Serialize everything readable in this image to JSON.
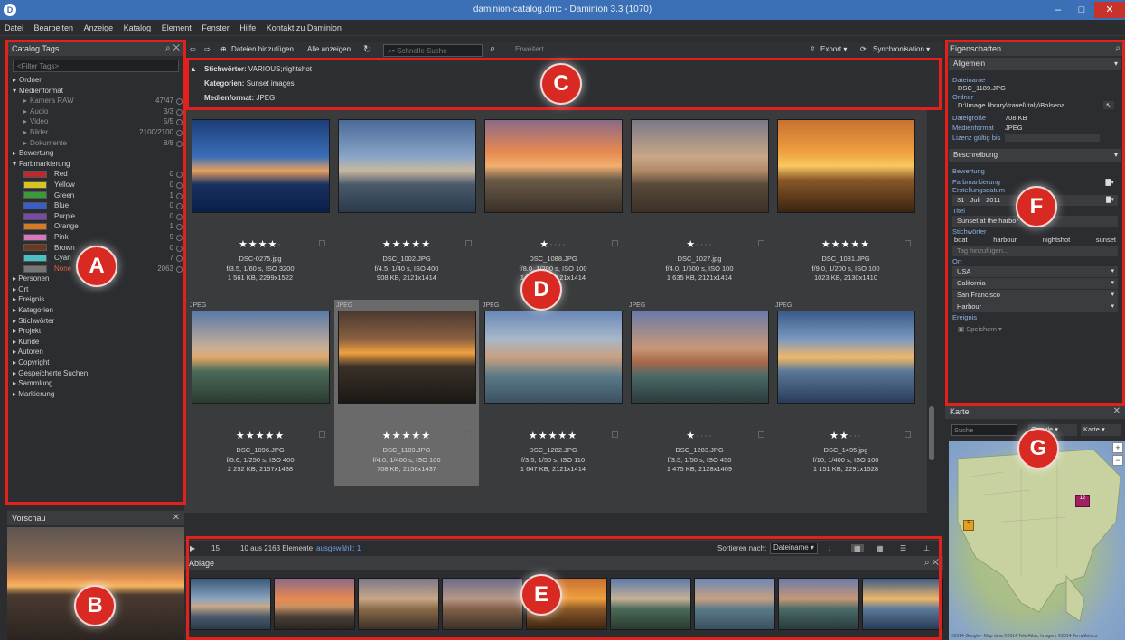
{
  "window": {
    "title": "daminion-catalog.dmc - Daminion 3.3 (1070)",
    "minimize": "–",
    "maximize": "□",
    "close": "✕"
  },
  "menu": [
    "Datei",
    "Bearbeiten",
    "Anzeige",
    "Katalog",
    "Element",
    "Fenster",
    "Hilfe",
    "Kontakt zu Daminion"
  ],
  "catalog_tags": {
    "title": "Catalog Tags",
    "filter_placeholder": "<Filter Tags>",
    "items": [
      {
        "label": "Ordner",
        "level": 0,
        "expander": "▸"
      },
      {
        "label": "Medienformat",
        "level": 0,
        "expander": "▾"
      },
      {
        "label": "Kamera RAW",
        "level": 1,
        "count": "47/47",
        "expander": "▸"
      },
      {
        "label": "Audio",
        "level": 1,
        "count": "3/3",
        "expander": "▸"
      },
      {
        "label": "Video",
        "level": 1,
        "count": "5/5",
        "expander": "▸"
      },
      {
        "label": "Bilder",
        "level": 1,
        "count": "2100/2100",
        "expander": "▸"
      },
      {
        "label": "Dokumente",
        "level": 1,
        "count": "8/8",
        "expander": "▸"
      },
      {
        "label": "Bewertung",
        "level": 0,
        "expander": "▸"
      },
      {
        "label": "Farbmarkierung",
        "level": 0,
        "expander": "▾"
      }
    ],
    "colors": [
      {
        "label": "Red",
        "count": "0",
        "color": "#c0282d"
      },
      {
        "label": "Yellow",
        "count": "0",
        "color": "#d8c620"
      },
      {
        "label": "Green",
        "count": "1",
        "color": "#3a9a3a"
      },
      {
        "label": "Blue",
        "count": "0",
        "color": "#3a5ec8"
      },
      {
        "label": "Purple",
        "count": "0",
        "color": "#7a4aa8"
      },
      {
        "label": "Orange",
        "count": "1",
        "color": "#d77a22"
      },
      {
        "label": "Pink",
        "count": "9",
        "color": "#d878b8"
      },
      {
        "label": "Brown",
        "count": "0",
        "color": "#6a3a1a"
      },
      {
        "label": "Cyan",
        "count": "7",
        "color": "#4ac0c0"
      },
      {
        "label": "None",
        "count": "2063",
        "color": "#777777",
        "highlight": true
      }
    ],
    "more_items": [
      "Personen",
      "Ort",
      "Ereignis",
      "Kategorien",
      "Stichwörter",
      "Projekt",
      "Kunde",
      "Autoren",
      "Copyright",
      "Gespeicherte Suchen",
      "Sammlung",
      "Markierung"
    ]
  },
  "preview": {
    "title": "Vorschau"
  },
  "toolbar": {
    "add_files": "Dateien hinzufügen",
    "show_all": "Alle anzeigen",
    "search_placeholder": "Schnelle Suche",
    "extended": "Erweitert",
    "export": "Export",
    "sync": "Synchronisation"
  },
  "filter_info": {
    "keywords_label": "Stichwörter:",
    "keywords_value": "VARIOUS;nightshot",
    "categories_label": "Kategorien:",
    "categories_value": "Sunset images",
    "media_label": "Medienformat:",
    "media_value": "JPEG"
  },
  "thumbs": [
    {
      "name": "DSC-0275.jpg",
      "exif": "f/3.5, 1/60 s, ISO 3200",
      "size": "1 561 KB, 2299x1522",
      "rating": 4,
      "fmt": "",
      "img": "linear-gradient(180deg,#1c3d78 0%,#3a6fb8 40%,#e8a060 55%,#183060 70%,#0a1e48 100%)"
    },
    {
      "name": "DSC_1002.JPG",
      "exif": "f/4.5, 1/40 s, ISO 400",
      "size": "908 KB, 2121x1414",
      "rating": 5,
      "fmt": "",
      "img": "linear-gradient(180deg,#4a6a98 0%,#8aa4c8 40%,#c8b8a0 55%,#4a5a6a 70%,#2a3a4a 100%)"
    },
    {
      "name": "DSC_1088.JPG",
      "exif": "f/8.0, 1/200 s, ISO 100",
      "size": "1 320 KB, 2121x1414",
      "rating": 1,
      "fmt": "",
      "img": "linear-gradient(180deg,#8a6a88 0%,#e88a50 35%,#f0b070 50%,#6a5a48 65%,#3a3028 100%)"
    },
    {
      "name": "DSC_1027.jpg",
      "exif": "f/4.0, 1/500 s, ISO 100",
      "size": "1 635 KB, 2121x1414",
      "rating": 1,
      "fmt": "",
      "img": "linear-gradient(180deg,#7a7888 0%,#c8a888 40%,#b08a68 55%,#5a4a3a 70%,#3a3028 100%)"
    },
    {
      "name": "DSC_1081.JPG",
      "exif": "f/9.0, 1/200 s, ISO 100",
      "size": "1023 KB, 2130x1410",
      "rating": 5,
      "fmt": "",
      "img": "linear-gradient(180deg,#c87030 0%,#f0a040 35%,#f8c860 50%,#8a5828 65%,#3a2410 100%)"
    },
    {
      "name": "DSC_1096.JPG",
      "exif": "f/5.6, 1/250 s, ISO 400",
      "size": "2 252 KB, 2157x1438",
      "rating": 5,
      "fmt": "JPEG",
      "img": "linear-gradient(180deg,#5a7aa8 0%,#c8b098 40%,#e0a868 50%,#4a6a58 65%,#2a3a30 100%)"
    },
    {
      "name": "DSC_1189.JPG",
      "exif": "f/4.0, 1/400 s, ISO 100",
      "size": "708 KB, 2156x1437",
      "rating": 5,
      "fmt": "JPEG",
      "img": "linear-gradient(180deg,#4a3a30 0%,#8a6040 30%,#f0a040 45%,#3a3028 60%,#1a1814 100%)"
    },
    {
      "name": "DSC_1282.JPG",
      "exif": "f/3.5, 1/50 s, ISO 110",
      "size": "1 647 KB, 2121x1414",
      "rating": 5,
      "fmt": "JPEG",
      "img": "linear-gradient(180deg,#6a88b8 0%,#a8b8c8 30%,#c8a080 50%,#5a7a88 70%,#3a5060 100%)"
    },
    {
      "name": "DSC_1283.JPG",
      "exif": "f/3.5, 1/50 s, ISO 450",
      "size": "1 475 KB, 2128x1409",
      "rating": 1,
      "fmt": "JPEG",
      "img": "linear-gradient(180deg,#6a7aa8 0%,#c89878 40%,#a86848 55%,#4a6a68 70%,#2a3a3a 100%)"
    },
    {
      "name": "DSC_1495.jpg",
      "exif": "f/10, 1/400 s, ISO 100",
      "size": "1 151 KB, 2291x1528",
      "rating": 2,
      "fmt": "JPEG",
      "img": "linear-gradient(180deg,#3a5a88 0%,#7a98c0 30%,#f0b868 50%,#5a7898 65%,#2a3a58 100%)"
    }
  ],
  "status": {
    "count_text": "15",
    "elements_text": "10 aus 2163 Elemente",
    "selected_text": "ausgewählt: 1",
    "sort_label": "Sortieren nach:",
    "sort_value": "Dateiname"
  },
  "filmstrip": {
    "title": "Ablage",
    "items": [
      "linear-gradient(180deg,#3a5878 0%,#8aa4c0 40%,#c8a888 55%,#4a5a6a 75%,#2a3a4a 100%)",
      "linear-gradient(180deg,#8a6a88 0%,#e88a50 40%,#c89060 55%,#4a4038 75%,#2a2420 100%)",
      "linear-gradient(180deg,#7a7888 0%,#c8a888 40%,#8a6a48 60%,#3a3028 100%)",
      "linear-gradient(180deg,#6a6a88 0%,#b89888 40%,#806048 60%,#3a3028 100%)",
      "linear-gradient(180deg,#c87030 0%,#f0a040 40%,#8a5828 60%,#3a2410 100%)",
      "linear-gradient(180deg,#5a7aa8 0%,#c8b098 40%,#4a6a58 60%,#2a3a30 100%)",
      "linear-gradient(180deg,#6a88b8 0%,#c8a080 40%,#5a7a88 60%,#3a5060 100%)",
      "linear-gradient(180deg,#6a7aa8 0%,#c89878 40%,#4a6a68 60%,#2a3a3a 100%)",
      "linear-gradient(180deg,#3a5a88 0%,#f0b868 40%,#5a7898 60%,#2a3a58 100%)"
    ]
  },
  "properties": {
    "title": "Eigenschaften",
    "general": "Allgemein",
    "filename_label": "Dateiname",
    "filename": "DSC_1189.JPG",
    "folder_label": "Ordner",
    "folder": "D:\\Image library\\travel\\Italy\\Bolsena",
    "filesize_label": "Dateigröße",
    "filesize": "708 KB",
    "media_label": "Medienformat",
    "media": "JPEG",
    "license_label": "Lizenz gültig bis",
    "description": "Beschreibung",
    "rating_label": "Bewertung",
    "colorlabel_label": "Farbmarkierung",
    "created_label": "Erstellungsdatum",
    "created_day": "31",
    "created_month": "Juli",
    "created_year": "2011",
    "title_label": "Titel",
    "title_value": "Sunset at the harbor",
    "keywords_label": "Stichwörter",
    "keywords": [
      "boat",
      "harbour",
      "nightshot",
      "sunset"
    ],
    "add_tag_placeholder": "Tag hinzufügen...",
    "place_label": "Ort",
    "places": [
      "USA",
      "California",
      "San Francisco",
      "Harbour"
    ],
    "event_label": "Ereignis",
    "save": "Speichern"
  },
  "map": {
    "title": "Karte",
    "search_placeholder": "Suche",
    "provider": "Google",
    "mode": "Karte",
    "credit": "©2014 Google - Map data ©2014 Tele Atlas, Imagery ©2014 TerraMetrics"
  },
  "annotations": [
    "A",
    "B",
    "C",
    "D",
    "E",
    "F",
    "G"
  ]
}
